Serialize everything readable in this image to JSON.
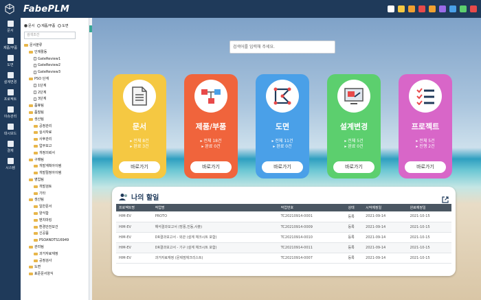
{
  "app": {
    "name": "FabePLM"
  },
  "rail": [
    {
      "label": "문서",
      "icon": "document-icon"
    },
    {
      "label": "제품/부품",
      "icon": "product-icon"
    },
    {
      "label": "도면",
      "icon": "drawing-icon"
    },
    {
      "label": "설계변경",
      "icon": "change-icon"
    },
    {
      "label": "프로젝트",
      "icon": "project-icon"
    },
    {
      "label": "이슈관리",
      "icon": "issue-icon"
    },
    {
      "label": "대시보드",
      "icon": "dashboard-icon"
    },
    {
      "label": "결재",
      "icon": "approval-icon"
    },
    {
      "label": "시스템",
      "icon": "settings-icon"
    }
  ],
  "tree_panel": {
    "radio_options": [
      "문서",
      "제품/부품",
      "도면"
    ],
    "search_placeholder": "검색조건",
    "nodes": [
      {
        "label": "문서분류",
        "type": "folder",
        "level": 0
      },
      {
        "label": "인재활동",
        "type": "folder",
        "level": 1
      },
      {
        "label": "GateReview1",
        "type": "doc",
        "level": 2
      },
      {
        "label": "GateReview2",
        "type": "doc",
        "level": 2
      },
      {
        "label": "GateReview3",
        "type": "doc",
        "level": 2
      },
      {
        "label": "PSO 단계",
        "type": "folder",
        "level": 1
      },
      {
        "label": "1단계",
        "type": "doc",
        "level": 2
      },
      {
        "label": "2단계",
        "type": "doc",
        "level": 2
      },
      {
        "label": "3단계",
        "type": "doc",
        "level": 2
      },
      {
        "label": "품휴팀",
        "type": "folder",
        "level": 1
      },
      {
        "label": "품질팀",
        "type": "folder",
        "level": 1
      },
      {
        "label": "생산팀",
        "type": "folder",
        "level": 1
      },
      {
        "label": "공정관리",
        "type": "folder",
        "level": 2
      },
      {
        "label": "실사자료",
        "type": "folder",
        "level": 2
      },
      {
        "label": "사후관리",
        "type": "folder",
        "level": 2
      },
      {
        "label": "업무보고",
        "type": "folder",
        "level": 2
      },
      {
        "label": "개정의뢰서",
        "type": "folder",
        "level": 2
      },
      {
        "label": "구매팀",
        "type": "folder",
        "level": 1
      },
      {
        "label": "개발계획아이템",
        "type": "folder",
        "level": 2
      },
      {
        "label": "개발절정아이템",
        "type": "folder",
        "level": 2
      },
      {
        "label": "영업팀",
        "type": "folder",
        "level": 1
      },
      {
        "label": "개발검토",
        "type": "folder",
        "level": 2
      },
      {
        "label": "기타",
        "type": "folder",
        "level": 2
      },
      {
        "label": "생산팀",
        "type": "folder",
        "level": 1
      },
      {
        "label": "일반문서",
        "type": "folder",
        "level": 2
      },
      {
        "label": "양식함",
        "type": "folder",
        "level": 2
      },
      {
        "label": "벤치마킹",
        "type": "folder",
        "level": 2
      },
      {
        "label": "환경안전보건",
        "type": "folder",
        "level": 2
      },
      {
        "label": "신공품",
        "type": "folder",
        "level": 2
      },
      {
        "label": "PSOANDTS16949",
        "type": "folder",
        "level": 2
      },
      {
        "label": "관리팀",
        "type": "folder",
        "level": 1
      },
      {
        "label": "과거자료재정",
        "type": "folder",
        "level": 2
      },
      {
        "label": "공정검사",
        "type": "folder",
        "level": 2
      },
      {
        "label": "도면",
        "type": "folder",
        "level": 1
      },
      {
        "label": "표준문서양식",
        "type": "folder",
        "level": 1
      }
    ]
  },
  "main": {
    "search_placeholder": "검색어를 입력해 주세요.",
    "cards": [
      {
        "title": "문서",
        "line1": "▸ 전체 8건",
        "line2": "▸ 완료 3건",
        "button": "바로가기",
        "color": "#f5c842",
        "icon": "document-icon"
      },
      {
        "title": "제품/부품",
        "line1": "▸ 전체 18건",
        "line2": "▸ 완료 0건",
        "button": "바로가기",
        "color": "#f0643c",
        "icon": "product-tree-icon"
      },
      {
        "title": "도면",
        "line1": "▸ 전체 11건",
        "line2": "▸ 완료 0건",
        "button": "바로가기",
        "color": "#4aa0e8",
        "icon": "drawing-icon"
      },
      {
        "title": "설계변경",
        "line1": "▸ 전체 5건",
        "line2": "▸ 완료 0건",
        "button": "바로가기",
        "color": "#5ccf6e",
        "icon": "design-change-icon"
      },
      {
        "title": "프로젝트",
        "line1": "▸ 전체 5건",
        "line2": "▸ 진행 2건",
        "button": "바로가기",
        "color": "#d866c8",
        "icon": "checklist-icon"
      }
    ],
    "todo": {
      "title": "나의 할일",
      "columns": [
        "프로젝트명",
        "작업명",
        "작업번호",
        "상태",
        "시작예정일",
        "완료예정일"
      ],
      "rows": [
        [
          "HIM-EV",
          "PROTO",
          "TC20210914-0001",
          "등록",
          "2021-09-14",
          "2021-10-15"
        ],
        [
          "HIM-EV",
          "해석결과보고서 (방풍,진동,사출)",
          "TC20210914-0009",
          "등록",
          "2021-09-14",
          "2021-10-15"
        ],
        [
          "HIM-EV",
          "DR결과보고서 - 외관 (설계 체크시트 포함)",
          "TC20210914-0010",
          "등록",
          "2021-09-14",
          "2021-10-15"
        ],
        [
          "HIM-EV",
          "DR결과보고서 - 기구 (설계 체크시트 포함)",
          "TC20210914-0011",
          "등록",
          "2021-09-14",
          "2021-10-15"
        ],
        [
          "HIM-EV",
          "과거자료재정 (문제점체크리스트)",
          "TC20210914-0007",
          "등록",
          "2021-09-14",
          "2021-10-15"
        ]
      ]
    }
  },
  "top_icons": [
    {
      "icon": "user-switch-icon",
      "color": "#ffffff"
    },
    {
      "icon": "bell-icon",
      "color": "#f5c842"
    },
    {
      "icon": "trash-icon",
      "color": "#f0a030"
    },
    {
      "icon": "globe-icon",
      "color": "#e84a4a"
    },
    {
      "icon": "folder-icon",
      "color": "#f0a030"
    },
    {
      "icon": "grid-icon",
      "color": "#9a6ae8"
    },
    {
      "icon": "user-icon",
      "color": "#4aa0e8"
    },
    {
      "icon": "export-icon",
      "color": "#5ccf6e"
    },
    {
      "icon": "power-icon",
      "color": "#e84a4a"
    }
  ]
}
